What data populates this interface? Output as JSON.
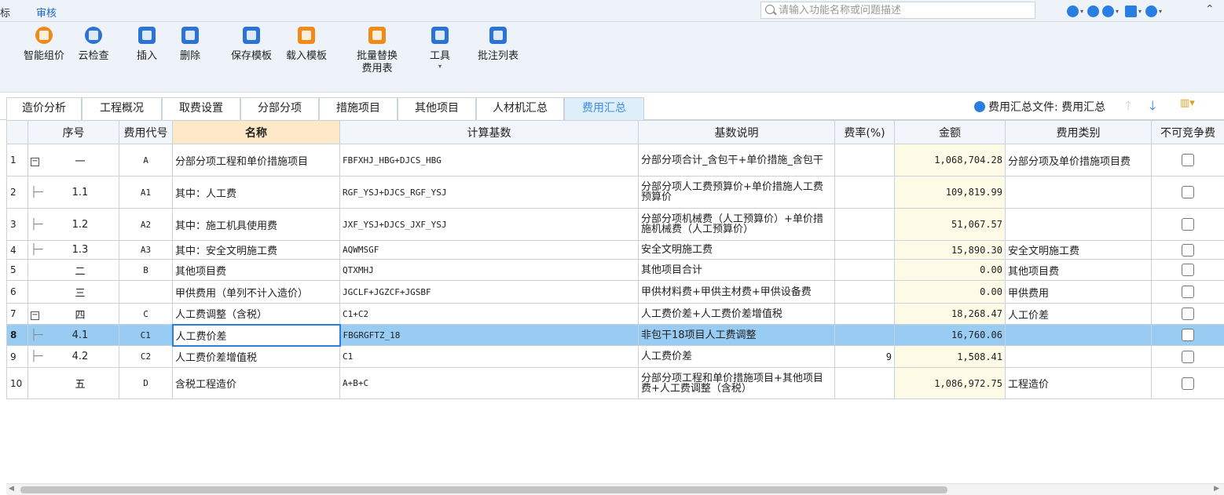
{
  "menubar": {
    "left_label": "标",
    "audit_label": "审核"
  },
  "search": {
    "placeholder": "请输入功能名称或问题描述"
  },
  "ribbon": {
    "items": [
      {
        "label": "智能组价"
      },
      {
        "label": "云检查"
      },
      {
        "label": "插入"
      },
      {
        "label": "删除"
      },
      {
        "label": "保存模板"
      },
      {
        "label": "载入模板"
      },
      {
        "label": "批量替换\n费用表"
      },
      {
        "label": "工具"
      },
      {
        "label": "批注列表"
      }
    ]
  },
  "tabs": [
    {
      "label": "造价分析"
    },
    {
      "label": "工程概况"
    },
    {
      "label": "取费设置"
    },
    {
      "label": "分部分项"
    },
    {
      "label": "措施项目"
    },
    {
      "label": "其他项目"
    },
    {
      "label": "人材机汇总"
    },
    {
      "label": "费用汇总"
    }
  ],
  "summary_file": {
    "label": "费用汇总文件: 费用汇总"
  },
  "grid": {
    "headers": [
      "序号",
      "费用代号",
      "名称",
      "计算基数",
      "基数说明",
      "费率(%)",
      "金额",
      "费用类别",
      "不可竞争费"
    ],
    "rows": [
      {
        "no": "1",
        "seq": "一",
        "code": "A",
        "name": "分部分项工程和单价措施项目",
        "base": "FBFXHJ_HBG+DJCS_HBG",
        "desc": "分部分项合计_含包干+单价措施_含包干",
        "rate": "",
        "amount": "1,068,704.28",
        "category": "分部分项及单价措施项目费",
        "level": 0,
        "collapse": "−"
      },
      {
        "no": "2",
        "seq": "1.1",
        "code": "A1",
        "name": "其中：人工费",
        "base": "RGF_YSJ+DJCS_RGF_YSJ",
        "desc": "分部分项人工费预算价+单价措施人工费预算价",
        "rate": "",
        "amount": "109,819.99",
        "category": "",
        "level": 1
      },
      {
        "no": "3",
        "seq": "1.2",
        "code": "A2",
        "name": "其中：施工机具使用费",
        "base": "JXF_YSJ+DJCS_JXF_YSJ",
        "desc": "分部分项机械费（人工预算价）+单价措施机械费（人工预算价）",
        "rate": "",
        "amount": "51,067.57",
        "category": "",
        "level": 1
      },
      {
        "no": "4",
        "seq": "1.3",
        "code": "A3",
        "name": "其中：安全文明施工费",
        "base": "AQWMSGF",
        "desc": "安全文明施工费",
        "rate": "",
        "amount": "15,890.30",
        "category": "安全文明施工费",
        "level": 1
      },
      {
        "no": "5",
        "seq": "二",
        "code": "B",
        "name": "其他项目费",
        "base": "QTXMHJ",
        "desc": "其他项目合计",
        "rate": "",
        "amount": "0.00",
        "category": "其他项目费",
        "level": 0
      },
      {
        "no": "6",
        "seq": "三",
        "code": "",
        "name": "甲供费用（单列不计入造价）",
        "base": "JGCLF+JGZCF+JGSBF",
        "desc": "甲供材料费+甲供主材费+甲供设备费",
        "rate": "",
        "amount": "0.00",
        "category": "甲供费用",
        "level": 0
      },
      {
        "no": "7",
        "seq": "四",
        "code": "C",
        "name": "人工费调整（含税）",
        "base": "C1+C2",
        "desc": "人工费价差+人工费价差增值税",
        "rate": "",
        "amount": "18,268.47",
        "category": "人工价差",
        "level": 0,
        "collapse": "−"
      },
      {
        "no": "8",
        "seq": "4.1",
        "code": "C1",
        "name": "人工费价差",
        "base": "FBGRGFTZ_18",
        "desc": "非包干18项目人工费调整",
        "rate": "",
        "amount": "16,760.06",
        "category": "",
        "level": 1,
        "selected": true
      },
      {
        "no": "9",
        "seq": "4.2",
        "code": "C2",
        "name": "人工费价差增值税",
        "base": "C1",
        "desc": "人工费价差",
        "rate": "9",
        "amount": "1,508.41",
        "category": "",
        "level": 1
      },
      {
        "no": "10",
        "seq": "五",
        "code": "D",
        "name": "含税工程造价",
        "base": "A+B+C",
        "desc": "分部分项工程和单价措施项目+其他项目费+人工费调整（含税）",
        "rate": "",
        "amount": "1,086,972.75",
        "category": "工程造价",
        "level": 0
      }
    ]
  }
}
